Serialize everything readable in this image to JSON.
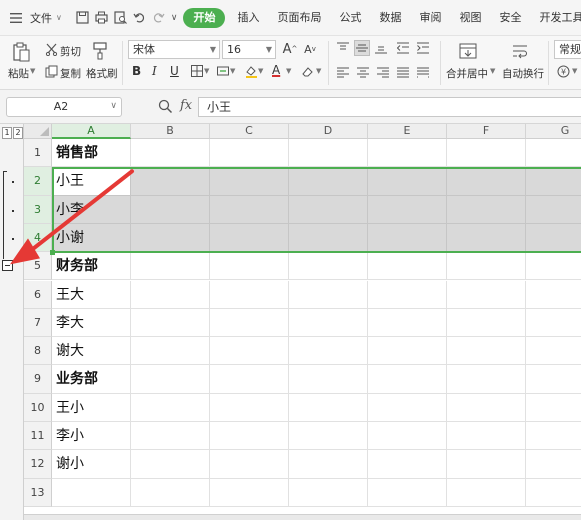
{
  "menubar": {
    "file_label": "文件",
    "tabs": [
      {
        "label": "开始",
        "active": true
      },
      {
        "label": "插入",
        "active": false
      },
      {
        "label": "页面布局",
        "active": false
      },
      {
        "label": "公式",
        "active": false
      },
      {
        "label": "数据",
        "active": false
      },
      {
        "label": "审阅",
        "active": false
      },
      {
        "label": "视图",
        "active": false
      },
      {
        "label": "安全",
        "active": false
      },
      {
        "label": "开发工具",
        "active": false
      }
    ]
  },
  "ribbon": {
    "paste_label": "粘贴",
    "cut_label": "剪切",
    "copy_label": "复制",
    "format_painter_label": "格式刷",
    "font_name": "宋体",
    "font_size": "16",
    "bold_label": "B",
    "italic_label": "I",
    "underline_label": "U",
    "font_color_label": "A",
    "merge_center_label": "合并居中",
    "wrap_text_label": "自动换行",
    "number_format_label": "常规",
    "accent_color": "#4caf50",
    "font_color_accent": "#d32f2f"
  },
  "formulabar": {
    "cell_reference": "A2",
    "fx_label": "fx",
    "formula_value": "小王"
  },
  "sheet": {
    "outline_levels": [
      "1",
      "2"
    ],
    "columns": [
      "A",
      "B",
      "C",
      "D",
      "E",
      "F",
      "G"
    ],
    "rows": [
      {
        "num": "1",
        "a": "销售部",
        "bold": true
      },
      {
        "num": "2",
        "a": "小王",
        "bold": false
      },
      {
        "num": "3",
        "a": "小李",
        "bold": false
      },
      {
        "num": "4",
        "a": "小谢",
        "bold": false
      },
      {
        "num": "5",
        "a": "财务部",
        "bold": true
      },
      {
        "num": "6",
        "a": "王大",
        "bold": false
      },
      {
        "num": "7",
        "a": "李大",
        "bold": false
      },
      {
        "num": "8",
        "a": "谢大",
        "bold": false
      },
      {
        "num": "9",
        "a": "业务部",
        "bold": true
      },
      {
        "num": "10",
        "a": "王小",
        "bold": false
      },
      {
        "num": "11",
        "a": "李小",
        "bold": false
      },
      {
        "num": "12",
        "a": "谢小",
        "bold": false
      },
      {
        "num": "13",
        "a": "",
        "bold": false
      }
    ],
    "selected_rows": [
      "2",
      "3",
      "4"
    ],
    "active_cell": "A2",
    "selection_color": "#4caf50",
    "annotation_arrow_color": "#e53935"
  }
}
